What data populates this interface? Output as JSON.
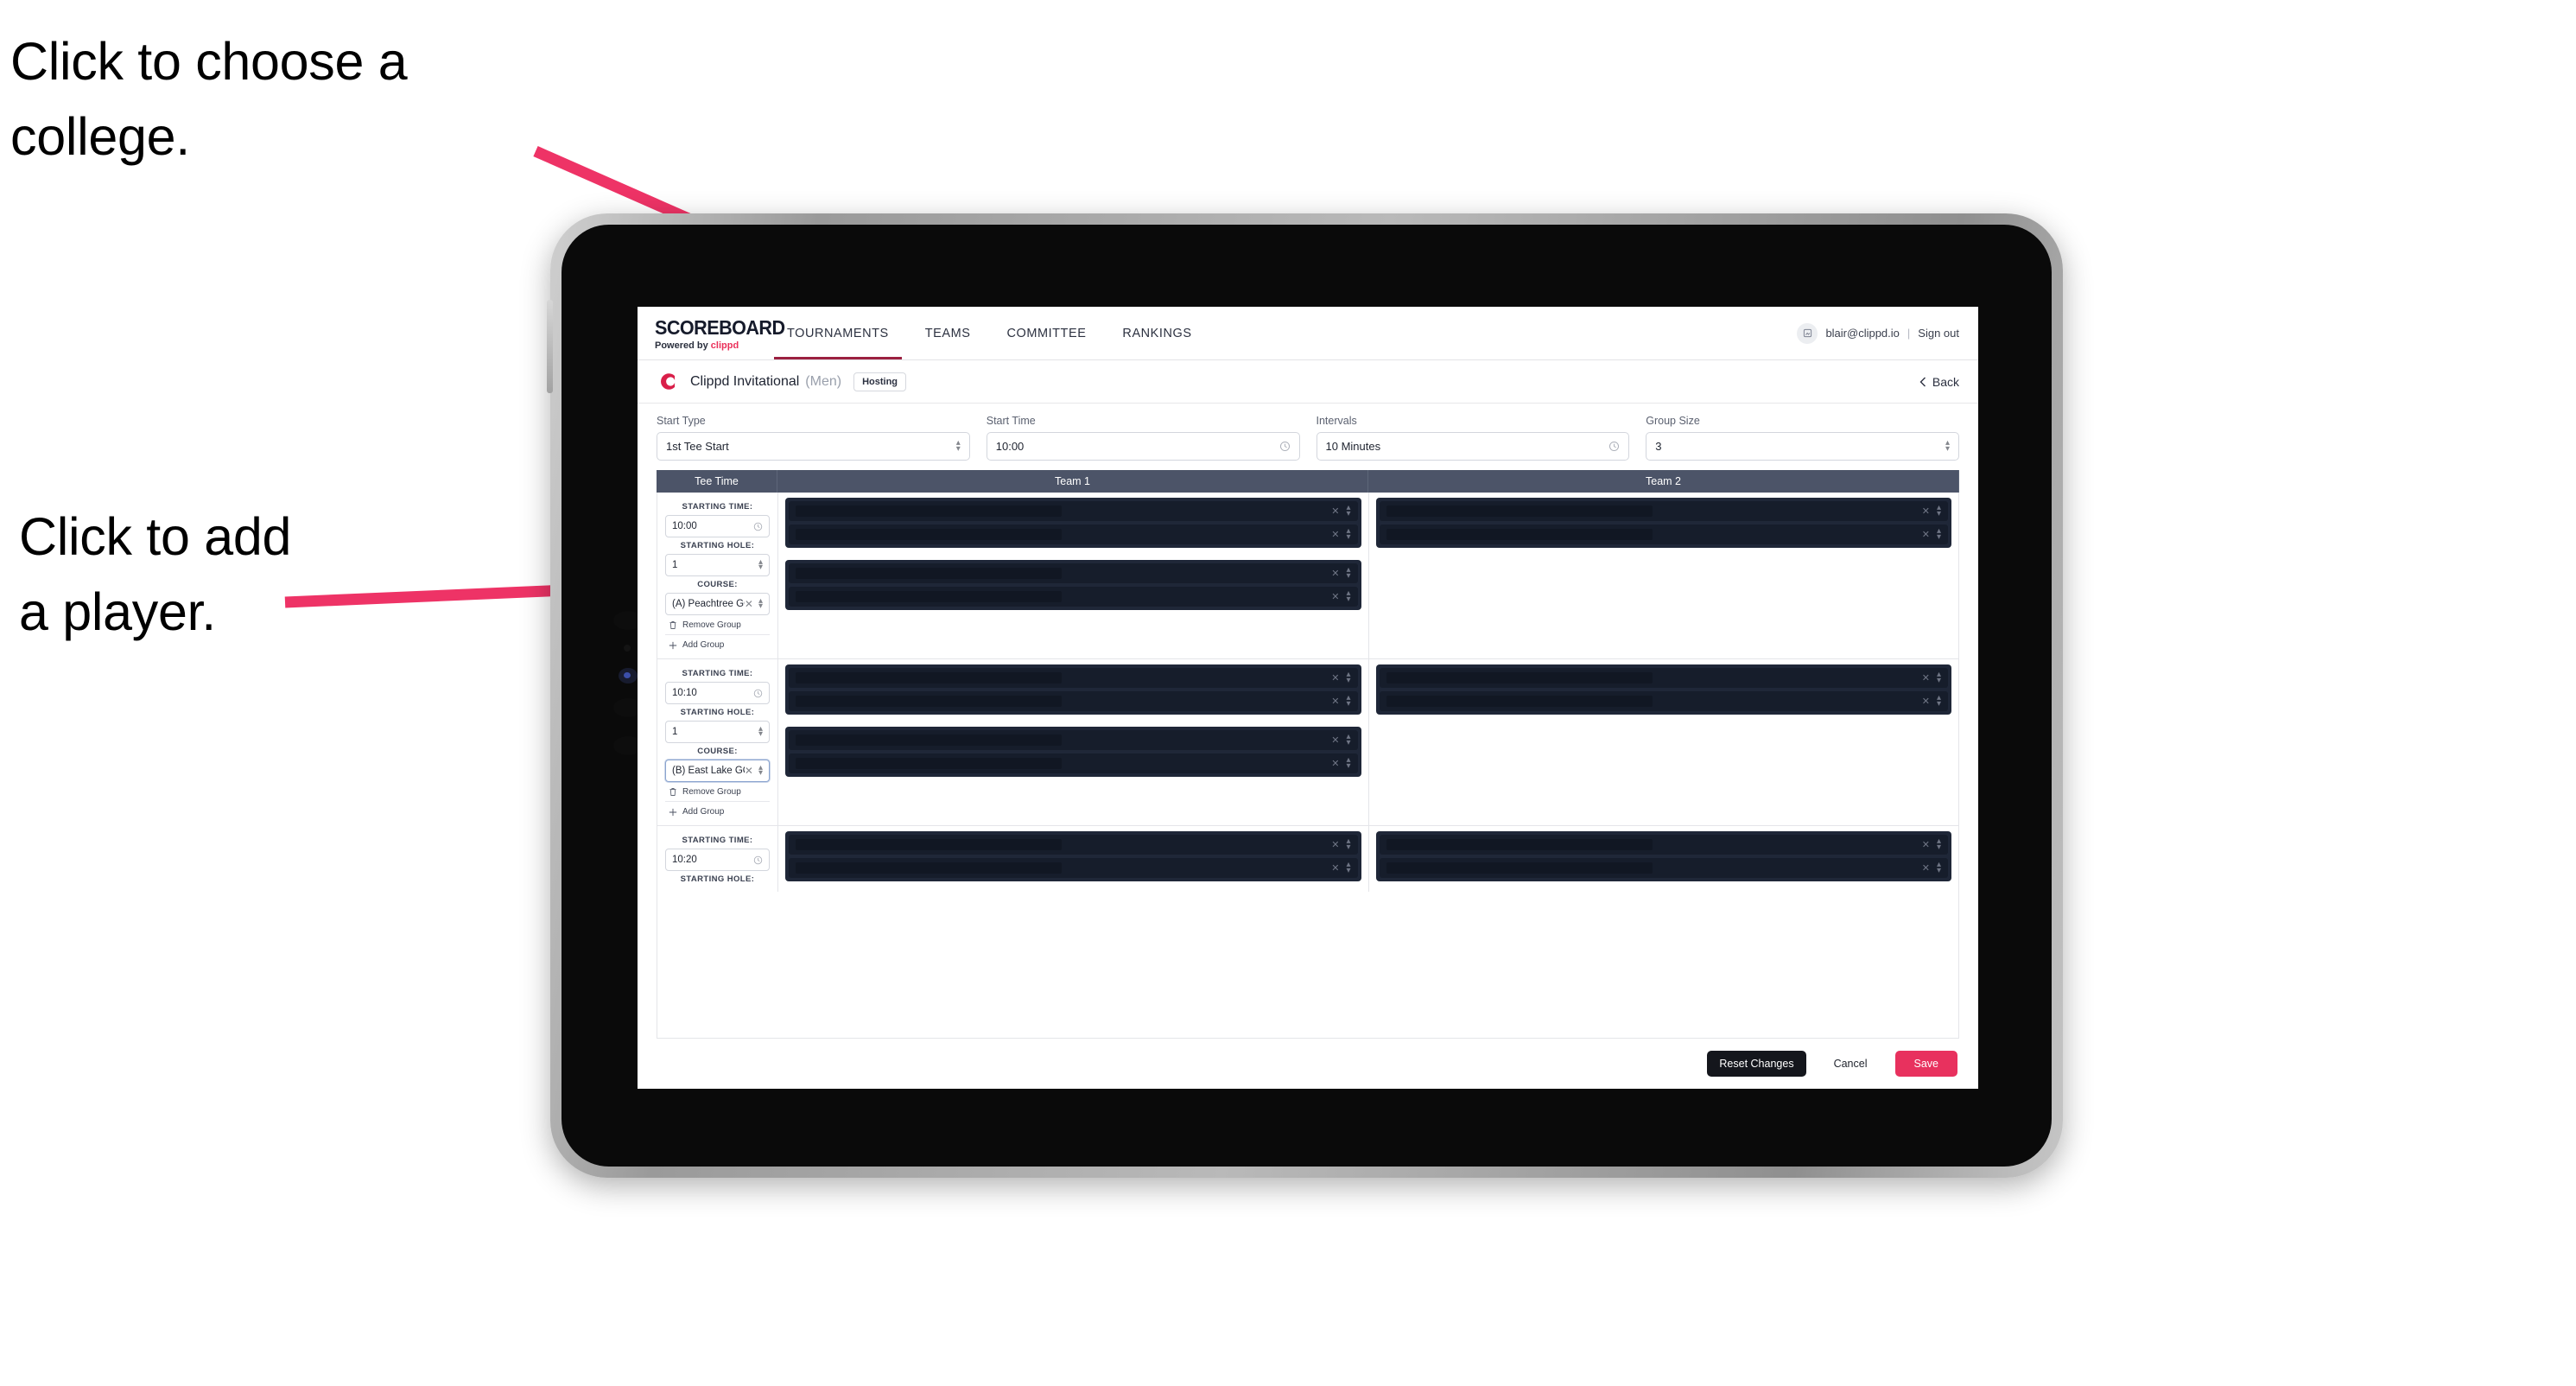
{
  "annotations": {
    "choose_college": "Click to choose a\ncollege.",
    "add_player": "Click to add\na player.",
    "arrow_color": "#ee3366"
  },
  "nav": {
    "brand_title": "SCOREBOARD",
    "brand_sub_prefix": "Powered by ",
    "brand_sub_accent": "clippd",
    "tabs": [
      {
        "label": "TOURNAMENTS",
        "active": true
      },
      {
        "label": "TEAMS",
        "active": false
      },
      {
        "label": "COMMITTEE",
        "active": false
      },
      {
        "label": "RANKINGS",
        "active": false
      }
    ],
    "user_email": "blair@clippd.io",
    "separator": "|",
    "sign_out": "Sign out",
    "avatar_icon": "user-avatar-icon"
  },
  "title_row": {
    "logo_icon": "clippd-c-logo",
    "tournament_name": "Clippd Invitational",
    "gender": "(Men)",
    "badge": "Hosting",
    "back_label": "Back",
    "back_icon": "chevron-left-icon"
  },
  "controls": [
    {
      "label": "Start Type",
      "value": "1st Tee Start",
      "icon": "stepper-icon"
    },
    {
      "label": "Start Time",
      "value": "10:00",
      "icon": "clock-icon"
    },
    {
      "label": "Intervals",
      "value": "10 Minutes",
      "icon": "clock-icon"
    },
    {
      "label": "Group Size",
      "value": "3",
      "icon": "stepper-icon"
    }
  ],
  "table": {
    "headers": {
      "tee_time": "Tee Time",
      "team1": "Team 1",
      "team2": "Team 2"
    },
    "field_labels": {
      "starting_time": "STARTING TIME:",
      "starting_hole": "STARTING HOLE:",
      "course": "COURSE:"
    },
    "group_actions": {
      "remove": "Remove Group",
      "remove_icon": "trash-icon",
      "add": "Add Group",
      "add_icon": "plus-icon"
    },
    "slot_icons": {
      "clear": "clear-x-icon",
      "stepper": "stepper-icon"
    },
    "rows": [
      {
        "starting_time": "10:00",
        "starting_hole": "1",
        "course": "(A) Peachtree GC",
        "course_focused": false,
        "team1_groups": 2,
        "team2_groups": 1,
        "slots_per_group": 2
      },
      {
        "starting_time": "10:10",
        "starting_hole": "1",
        "course": "(B) East Lake GC",
        "course_focused": true,
        "team1_groups": 2,
        "team2_groups": 1,
        "slots_per_group": 2
      },
      {
        "starting_time": "10:20",
        "starting_hole": "",
        "course": "",
        "course_focused": false,
        "team1_groups": 1,
        "team2_groups": 1,
        "slots_per_group": 2,
        "partial": true
      }
    ]
  },
  "footer": {
    "reset_label": "Reset Changes",
    "cancel_label": "Cancel",
    "save_label": "Save"
  },
  "colors": {
    "accent_pink": "#e8315e",
    "header_slate": "#4c5468",
    "panel_dark": "#1f2738",
    "slot_dark": "#161d2b",
    "tab_underline": "#9b2040"
  }
}
